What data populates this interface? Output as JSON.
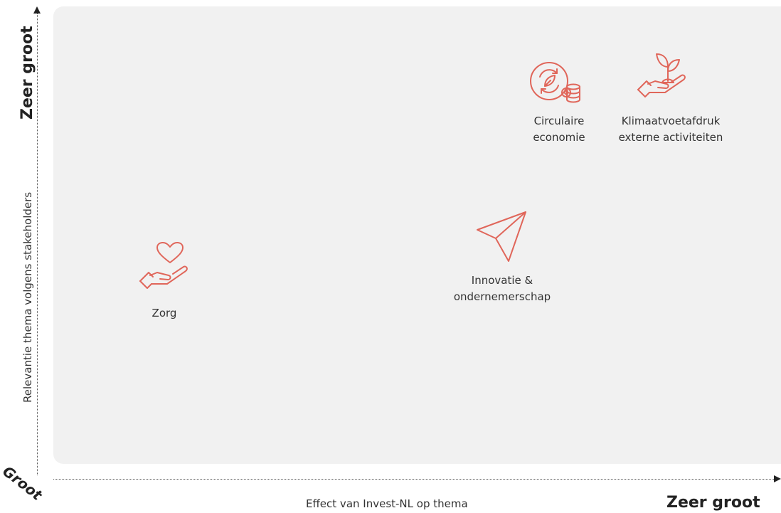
{
  "axes": {
    "y_label": "Relevantie thema volgens stakeholders",
    "y_high": "Zeer groot",
    "origin": "Groot",
    "x_label": "Effect van Invest-NL op thema",
    "x_high": "Zeer groot"
  },
  "themes": [
    {
      "label_line1": "Circulaire",
      "label_line2": "economie",
      "icon": "circular-economy-icon"
    },
    {
      "label_line1": "Klimaatvoetafdruk",
      "label_line2": "externe activiteiten",
      "icon": "plant-in-hand-icon"
    },
    {
      "label_line1": "Innovatie &",
      "label_line2": "ondernemerschap",
      "icon": "paper-plane-icon"
    },
    {
      "label_line1": "Zorg",
      "label_line2": "",
      "icon": "heart-in-hand-icon"
    }
  ],
  "colors": {
    "icon": "#e0665a",
    "panel": "#f1f1f1"
  }
}
